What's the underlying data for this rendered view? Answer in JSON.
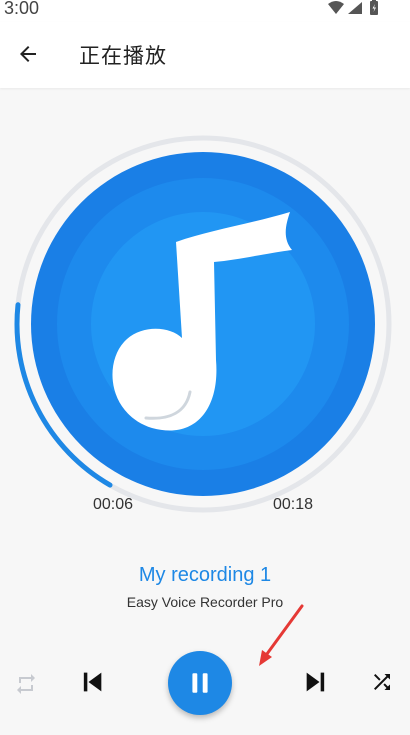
{
  "status_bar": {
    "time": "3:00"
  },
  "app_bar": {
    "title": "正在播放"
  },
  "player": {
    "elapsed": "00:06",
    "total": "00:18",
    "progress_fraction": 0.333,
    "track_title": "My recording 1",
    "track_artist": "Easy Voice Recorder Pro",
    "state": "playing"
  },
  "colors": {
    "accent": "#1e88e5",
    "disc_outer": "#1a7fe6",
    "disc_inner": "#2196f3",
    "annotation": "#e53935"
  },
  "icons": {
    "back": "arrow-left-icon",
    "repeat": "repeat-icon",
    "previous": "skip-previous-icon",
    "pause": "pause-icon",
    "next": "skip-next-icon",
    "shuffle": "shuffle-icon",
    "artwork": "music-note-icon"
  }
}
